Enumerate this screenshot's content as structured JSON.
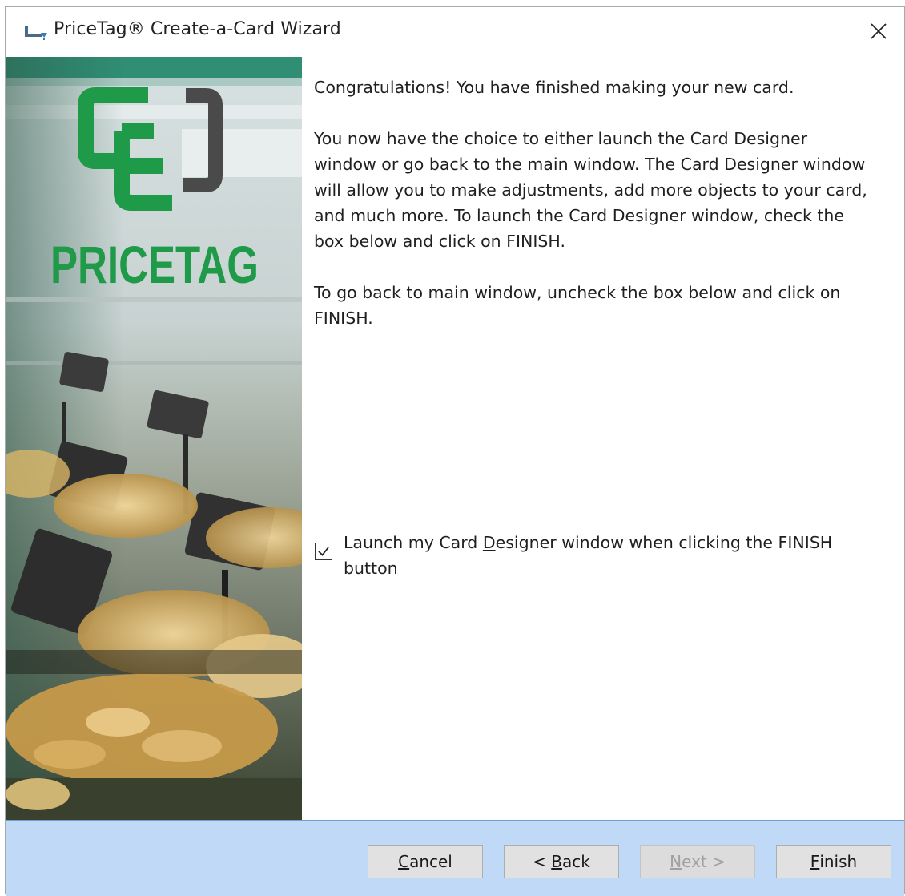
{
  "window": {
    "title": "PriceTag® Create-a-Card Wizard"
  },
  "side_panel": {
    "logo_text": "PRICETAG",
    "logo_green": "#1f9a48",
    "logo_gray": "#4a4a4a"
  },
  "content": {
    "paragraph_1": "Congratulations! You have finished making your new card.",
    "paragraph_2": "You now have the choice to either launch the Card Designer window or go back to the main window. The Card Designer window will allow you to make adjustments, add more objects to your card, and much more. To launch the Card Designer window, check the box below and click on FINISH.",
    "paragraph_3": "To go back to main window, uncheck the box below and click on FINISH."
  },
  "launch_checkbox": {
    "checked": true,
    "label_before": "Launch my Card ",
    "label_underlined": "D",
    "label_after": "esigner window when clicking the FINISH button"
  },
  "buttons": {
    "cancel": {
      "underlined": "C",
      "rest": "ancel"
    },
    "back": {
      "prefix": "< ",
      "underlined": "B",
      "rest": "ack"
    },
    "next": {
      "underlined": "N",
      "rest": "ext >",
      "enabled": false
    },
    "finish": {
      "underlined": "F",
      "rest": "inish"
    }
  },
  "colors": {
    "footer_bg": "#bfd9f6",
    "accent_green": "#1f9a48"
  }
}
